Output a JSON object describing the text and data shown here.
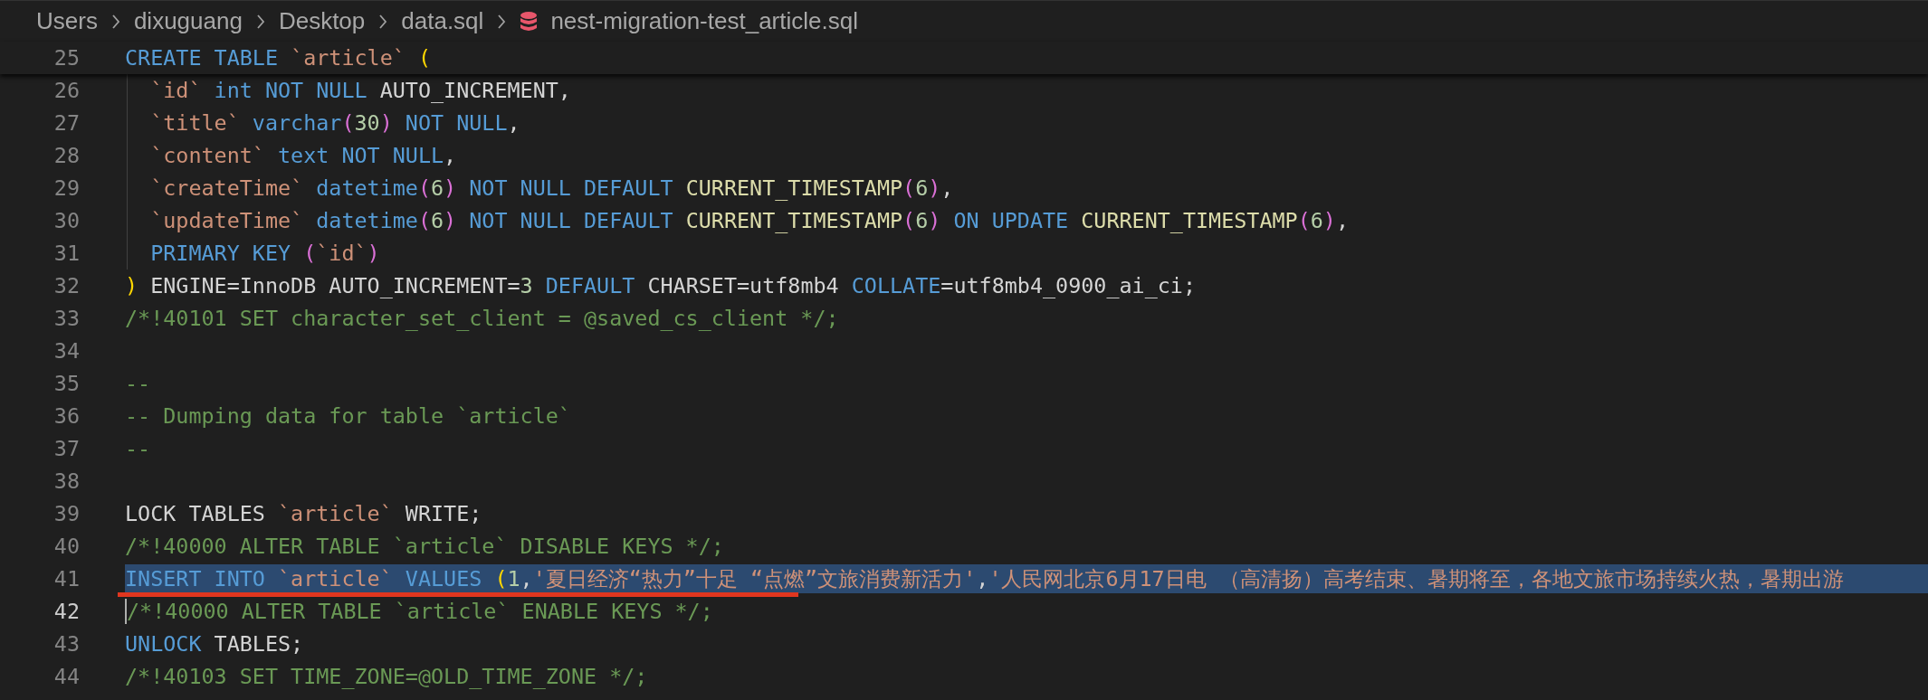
{
  "breadcrumbs": [
    {
      "label": "Users",
      "kind": "folder"
    },
    {
      "label": "dixuguang",
      "kind": "folder"
    },
    {
      "label": "Desktop",
      "kind": "folder"
    },
    {
      "label": "data.sql",
      "kind": "folder"
    },
    {
      "label": "nest-migration-test_article.sql",
      "kind": "file"
    }
  ],
  "sticky_line": {
    "number": "25",
    "tokens": [
      {
        "kind": "kw",
        "text": "CREATE TABLE "
      },
      {
        "kind": "ident",
        "text": "`article`"
      },
      {
        "kind": "p1",
        "text": " ("
      }
    ]
  },
  "lines": [
    {
      "number": "26",
      "active": false,
      "selected": false,
      "indent_guide": true,
      "tokens": [
        {
          "kind": "ident",
          "text": "`id`"
        },
        {
          "kind": "kw",
          "text": " int NOT NULL"
        },
        {
          "kind": "plain",
          "text": " AUTO_INCREMENT,"
        }
      ]
    },
    {
      "number": "27",
      "active": false,
      "selected": false,
      "indent_guide": true,
      "tokens": [
        {
          "kind": "ident",
          "text": "`title`"
        },
        {
          "kind": "kw",
          "text": " varchar"
        },
        {
          "kind": "p2",
          "text": "("
        },
        {
          "kind": "num",
          "text": "30"
        },
        {
          "kind": "p2",
          "text": ")"
        },
        {
          "kind": "kw",
          "text": " NOT NULL"
        },
        {
          "kind": "plain",
          "text": ","
        }
      ]
    },
    {
      "number": "28",
      "active": false,
      "selected": false,
      "indent_guide": true,
      "tokens": [
        {
          "kind": "ident",
          "text": "`content`"
        },
        {
          "kind": "kw",
          "text": " text NOT NULL"
        },
        {
          "kind": "plain",
          "text": ","
        }
      ]
    },
    {
      "number": "29",
      "active": false,
      "selected": false,
      "indent_guide": true,
      "tokens": [
        {
          "kind": "ident",
          "text": "`createTime`"
        },
        {
          "kind": "kw",
          "text": " datetime"
        },
        {
          "kind": "p2",
          "text": "("
        },
        {
          "kind": "num",
          "text": "6"
        },
        {
          "kind": "p2",
          "text": ")"
        },
        {
          "kind": "kw",
          "text": " NOT NULL DEFAULT "
        },
        {
          "kind": "fn",
          "text": "CURRENT_TIMESTAMP"
        },
        {
          "kind": "p2",
          "text": "("
        },
        {
          "kind": "num",
          "text": "6"
        },
        {
          "kind": "p2",
          "text": ")"
        },
        {
          "kind": "plain",
          "text": ","
        }
      ]
    },
    {
      "number": "30",
      "active": false,
      "selected": false,
      "indent_guide": true,
      "tokens": [
        {
          "kind": "ident",
          "text": "`updateTime`"
        },
        {
          "kind": "kw",
          "text": " datetime"
        },
        {
          "kind": "p2",
          "text": "("
        },
        {
          "kind": "num",
          "text": "6"
        },
        {
          "kind": "p2",
          "text": ")"
        },
        {
          "kind": "kw",
          "text": " NOT NULL DEFAULT "
        },
        {
          "kind": "fn",
          "text": "CURRENT_TIMESTAMP"
        },
        {
          "kind": "p2",
          "text": "("
        },
        {
          "kind": "num",
          "text": "6"
        },
        {
          "kind": "p2",
          "text": ")"
        },
        {
          "kind": "kw",
          "text": " ON UPDATE "
        },
        {
          "kind": "fn",
          "text": "CURRENT_TIMESTAMP"
        },
        {
          "kind": "p2",
          "text": "("
        },
        {
          "kind": "num",
          "text": "6"
        },
        {
          "kind": "p2",
          "text": ")"
        },
        {
          "kind": "plain",
          "text": ","
        }
      ]
    },
    {
      "number": "31",
      "active": false,
      "selected": false,
      "indent_guide": true,
      "tokens": [
        {
          "kind": "kw",
          "text": "PRIMARY KEY "
        },
        {
          "kind": "p2",
          "text": "("
        },
        {
          "kind": "ident",
          "text": "`id`"
        },
        {
          "kind": "p2",
          "text": ")"
        }
      ]
    },
    {
      "number": "32",
      "active": false,
      "selected": false,
      "indent_guide": false,
      "tokens": [
        {
          "kind": "p1",
          "text": ")"
        },
        {
          "kind": "plain",
          "text": " ENGINE=InnoDB AUTO_INCREMENT="
        },
        {
          "kind": "num",
          "text": "3"
        },
        {
          "kind": "kw",
          "text": " DEFAULT"
        },
        {
          "kind": "plain",
          "text": " CHARSET=utf8mb4 "
        },
        {
          "kind": "kw",
          "text": "COLLATE"
        },
        {
          "kind": "plain",
          "text": "=utf8mb4_0900_ai_ci;"
        }
      ]
    },
    {
      "number": "33",
      "active": false,
      "selected": false,
      "indent_guide": false,
      "tokens": [
        {
          "kind": "comment",
          "text": "/*!40101 SET character_set_client = @saved_cs_client */;"
        }
      ]
    },
    {
      "number": "34",
      "active": false,
      "selected": false,
      "indent_guide": false
    },
    {
      "number": "35",
      "active": false,
      "selected": false,
      "indent_guide": false,
      "tokens": [
        {
          "kind": "comment",
          "text": "--"
        }
      ]
    },
    {
      "number": "36",
      "active": false,
      "selected": false,
      "indent_guide": false,
      "tokens": [
        {
          "kind": "comment",
          "text": "-- Dumping data for table `article`"
        }
      ]
    },
    {
      "number": "37",
      "active": false,
      "selected": false,
      "indent_guide": false,
      "tokens": [
        {
          "kind": "comment",
          "text": "--"
        }
      ]
    },
    {
      "number": "38",
      "active": false,
      "selected": false,
      "indent_guide": false
    },
    {
      "number": "39",
      "active": false,
      "selected": false,
      "indent_guide": false,
      "tokens": [
        {
          "kind": "plain",
          "text": "LOCK TABLES "
        },
        {
          "kind": "ident",
          "text": "`article`"
        },
        {
          "kind": "plain",
          "text": " WRITE;"
        }
      ]
    },
    {
      "number": "40",
      "active": false,
      "selected": false,
      "indent_guide": false,
      "tokens": [
        {
          "kind": "comment",
          "text": "/*!40000 ALTER TABLE `article` DISABLE KEYS */;"
        }
      ]
    },
    {
      "number": "41",
      "active": false,
      "selected": true,
      "indent_guide": false,
      "tokens": [
        {
          "kind": "kw",
          "text": "INSERT INTO "
        },
        {
          "kind": "ident",
          "text": "`article`"
        },
        {
          "kind": "kw",
          "text": " VALUES "
        },
        {
          "kind": "p1",
          "text": "("
        },
        {
          "kind": "num",
          "text": "1"
        },
        {
          "kind": "plain",
          "text": ","
        },
        {
          "kind": "string",
          "text": "'夏日经济“热力”十足 “点燃”文旅消费新活力'"
        },
        {
          "kind": "plain",
          "text": ","
        },
        {
          "kind": "string",
          "text": "'人民网北京6月17日电 （高清扬）高考结束、暑期将至，各地文旅市场持续火热，暑期出游"
        }
      ]
    },
    {
      "number": "42",
      "active": true,
      "selected": false,
      "indent_guide": false,
      "tokens": [
        {
          "kind": "comment",
          "text": "/*!40000 ALTER TABLE `article` ENABLE KEYS */;"
        }
      ]
    },
    {
      "number": "43",
      "active": false,
      "selected": false,
      "indent_guide": false,
      "tokens": [
        {
          "kind": "kw",
          "text": "UNLOCK"
        },
        {
          "kind": "plain",
          "text": " TABLES;"
        }
      ]
    },
    {
      "number": "44",
      "active": false,
      "selected": false,
      "indent_guide": false,
      "tokens": [
        {
          "kind": "comment",
          "text": "/*!40103 SET TIME_ZONE=@OLD_TIME_ZONE */;"
        }
      ]
    }
  ]
}
